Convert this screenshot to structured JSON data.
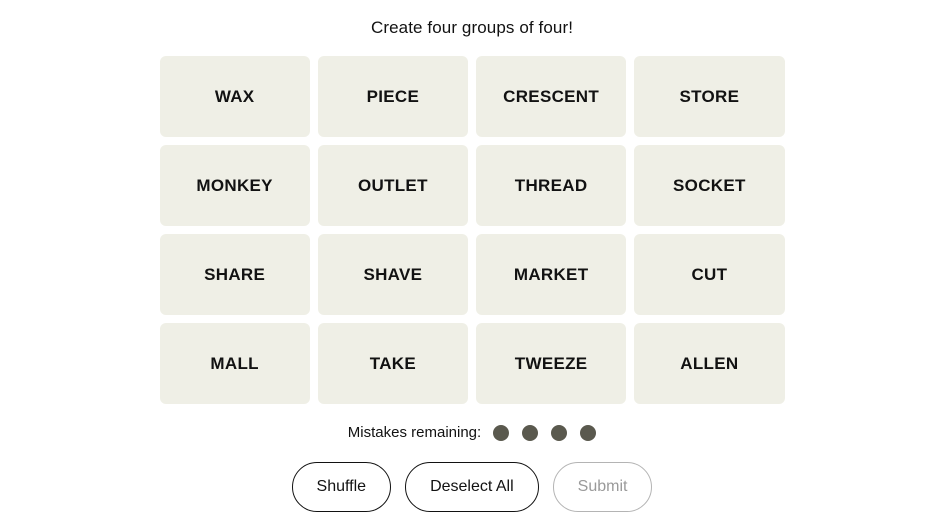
{
  "page": {
    "title": "Create four groups of four!",
    "background_color": "#ffffff"
  },
  "board": {
    "tile_background_color": "#efefe6",
    "tile_text_color": "#121212",
    "rows": 4,
    "columns": 4,
    "tiles": [
      {
        "label": "WAX"
      },
      {
        "label": "PIECE"
      },
      {
        "label": "CRESCENT"
      },
      {
        "label": "STORE"
      },
      {
        "label": "MONKEY"
      },
      {
        "label": "OUTLET"
      },
      {
        "label": "THREAD"
      },
      {
        "label": "SOCKET"
      },
      {
        "label": "SHARE"
      },
      {
        "label": "SHAVE"
      },
      {
        "label": "MARKET"
      },
      {
        "label": "CUT"
      },
      {
        "label": "MALL"
      },
      {
        "label": "TAKE"
      },
      {
        "label": "TWEEZE"
      },
      {
        "label": "ALLEN"
      }
    ]
  },
  "mistakes": {
    "label": "Mistakes remaining:",
    "remaining": 4,
    "dot_color": "#5a594e",
    "dots": [
      {
        "name": "mistake-dot-1"
      },
      {
        "name": "mistake-dot-2"
      },
      {
        "name": "mistake-dot-3"
      },
      {
        "name": "mistake-dot-4"
      }
    ]
  },
  "controls": {
    "shuffle_label": "Shuffle",
    "deselect_label": "Deselect All",
    "submit_label": "Submit",
    "submit_disabled": true,
    "enabled_border_color": "#121212",
    "disabled_border_color": "#b4b4b4",
    "disabled_text_color": "#9a9a9a"
  }
}
